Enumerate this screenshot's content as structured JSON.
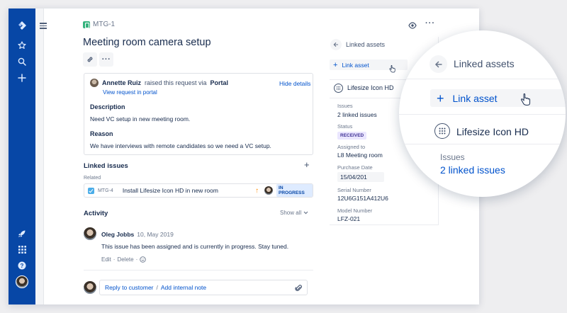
{
  "issue": {
    "key": "MTG-1",
    "title": "Meeting room camera setup"
  },
  "request": {
    "reporter": "Annette Ruiz",
    "raised_text": "raised this request via",
    "channel": "Portal",
    "hide_details": "Hide details",
    "view_portal": "View request in portal",
    "description_label": "Description",
    "description": "Need VC setup in new meeting room.",
    "reason_label": "Reason",
    "reason": "We have interviews with remote candidates so we need a VC setup."
  },
  "linked_issues": {
    "heading": "Linked issues",
    "add": "+",
    "related_label": "Related",
    "items": [
      {
        "key": "MTG-4",
        "summary": "Install Lifesize Icon HD in new room",
        "status": "IN PROGRESS"
      }
    ]
  },
  "activity": {
    "heading": "Activity",
    "show_all": "Show all",
    "comment": {
      "author": "Oleg Jobbs",
      "date": "10, May 2019",
      "body": "This issue has been assigned and is currently in progress. Stay tuned.",
      "edit": "Edit",
      "sep": "·",
      "delete": "Delete"
    },
    "reply_to_customer": "Reply to customer",
    "divider": "/",
    "add_internal_note": "Add internal note"
  },
  "linked_assets": {
    "heading": "Linked assets",
    "link_asset": "Link asset",
    "asset": {
      "name": "Lifesize Icon HD",
      "fields": [
        {
          "label": "Issues",
          "value": "2 linked issues"
        },
        {
          "label": "Status",
          "value": "RECEIVED"
        },
        {
          "label": "Assigned to",
          "value": "L8 Meeting room"
        },
        {
          "label": "Purchase Date",
          "value": "15/04/201"
        },
        {
          "label": "Serial Number",
          "value": "12U6G151A412U6"
        },
        {
          "label": "Model Number",
          "value": "LFZ-021"
        }
      ]
    }
  },
  "magnifier": {
    "heading": "Linked assets",
    "link_asset": "Link asset",
    "asset_name": "Lifesize Icon HD",
    "issues_label": "Issues",
    "issues_value": "2 linked issues"
  },
  "icons": [
    "jira-logo-icon",
    "star-icon",
    "search-icon",
    "plus-icon",
    "rocket-icon",
    "apps-grid-icon",
    "help-icon",
    "watch-eye-icon",
    "more-icon",
    "link-icon",
    "back-arrow-icon",
    "cursor-hand-icon",
    "attachment-icon",
    "emoji-icon",
    "priority-high-icon",
    "chevron-down-icon"
  ],
  "colors": {
    "nav": "#0747a6",
    "link": "#0052cc",
    "in_progress_bg": "#deebff",
    "received_bg": "#eae6ff",
    "priority": "#ff8b00"
  }
}
